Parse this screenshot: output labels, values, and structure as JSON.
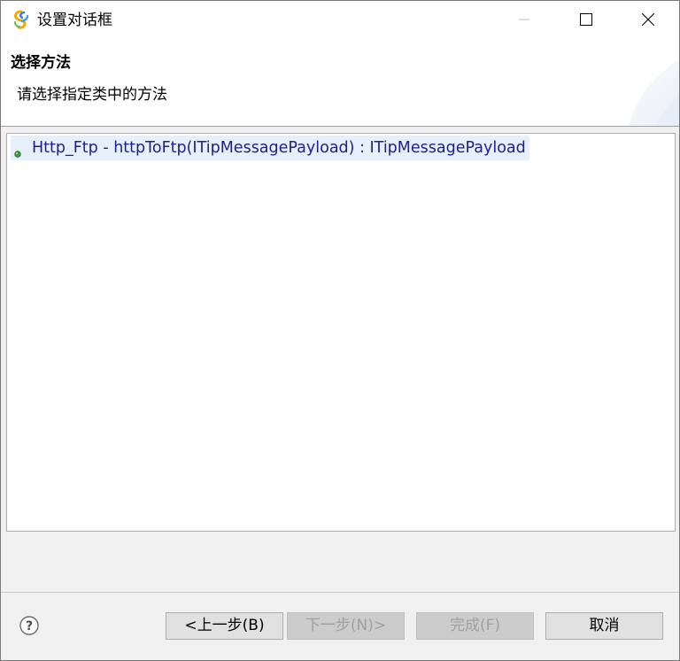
{
  "window": {
    "title": "设置对话框",
    "controls": {
      "minimize_icon": "minimize-icon",
      "maximize_icon": "maximize-icon",
      "close_icon": "close-icon"
    }
  },
  "banner": {
    "title": "选择方法",
    "description": "请选择指定类中的方法"
  },
  "method_list": {
    "items": [
      {
        "label": "Http_Ftp - httpToFtp(ITipMessagePayload) : ITipMessagePayload",
        "icon": "public-method-icon",
        "selected": true
      }
    ]
  },
  "footer": {
    "help_icon": "help-icon",
    "back_label": "<上一步(B)",
    "next_label": "下一步(N)>",
    "finish_label": "完成(F)",
    "cancel_label": "取消",
    "next_enabled": false,
    "finish_enabled": false
  },
  "colors": {
    "selection": "#e5f0fb",
    "method_text": "#1e1e8c",
    "method_dot": "#3c9a3c",
    "button_bg": "#e1e1e1"
  }
}
